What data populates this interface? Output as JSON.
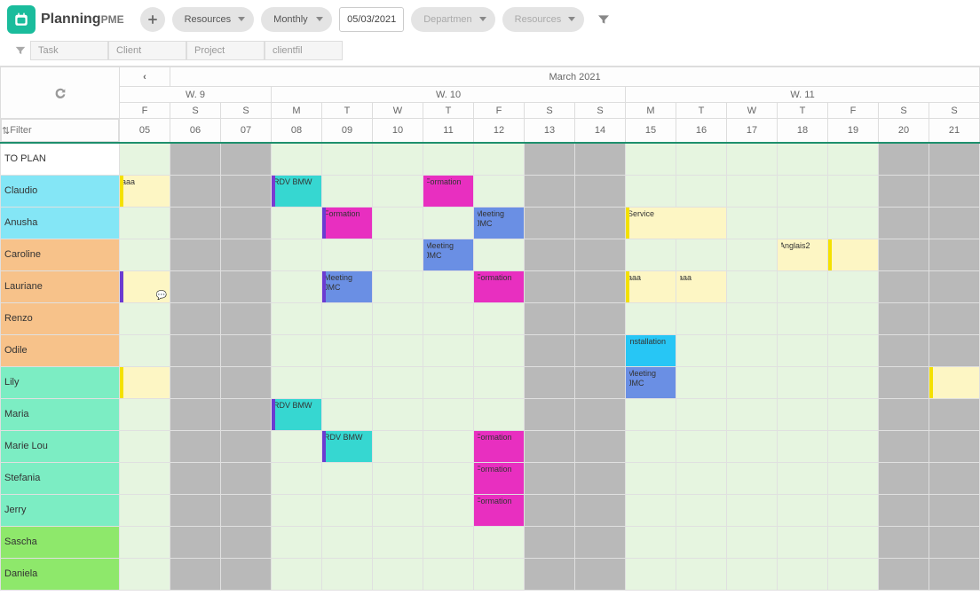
{
  "app": {
    "name": "Planning",
    "suffix": "PME"
  },
  "toolbar": {
    "resources_sel": "Resources",
    "view_sel": "Monthly",
    "date": "05/03/2021",
    "department_sel": "Departmen",
    "resources_sel2": "Resources"
  },
  "filters": {
    "task": "Task",
    "client": "Client",
    "project": "Project",
    "clientfil": "clientfil"
  },
  "calendar": {
    "month_label": "March 2021",
    "weeks": [
      "W. 9",
      "W. 10",
      "W. 11"
    ],
    "week_spans": [
      3,
      7,
      7
    ],
    "days": [
      "F",
      "S",
      "S",
      "M",
      "T",
      "W",
      "T",
      "F",
      "S",
      "S",
      "M",
      "T",
      "W",
      "T",
      "F",
      "S",
      "S"
    ],
    "daynums": [
      "05",
      "06",
      "07",
      "08",
      "09",
      "10",
      "11",
      "12",
      "13",
      "14",
      "15",
      "16",
      "17",
      "18",
      "19",
      "20",
      "21"
    ],
    "weekend_cols": [
      1,
      2,
      8,
      9,
      15,
      16
    ],
    "lightgreen_cols": [
      0,
      3,
      4,
      5,
      6,
      7,
      10,
      11,
      12,
      13,
      14
    ],
    "filter_placeholder": "Filter"
  },
  "resources": [
    {
      "name": "TO PLAN",
      "color": "#ffffff"
    },
    {
      "name": "Claudio",
      "color": "#84e6f6"
    },
    {
      "name": "Anusha",
      "color": "#84e6f6"
    },
    {
      "name": "Caroline",
      "color": "#f7c28a"
    },
    {
      "name": "Lauriane",
      "color": "#f7c28a"
    },
    {
      "name": "Renzo",
      "color": "#f7c28a"
    },
    {
      "name": "Odile",
      "color": "#f7c28a"
    },
    {
      "name": "Lily",
      "color": "#7cedc3"
    },
    {
      "name": "Maria",
      "color": "#7cedc3"
    },
    {
      "name": "Marie Lou",
      "color": "#7cedc3"
    },
    {
      "name": "Stefania",
      "color": "#7cedc3"
    },
    {
      "name": "Jerry",
      "color": "#7cedc3"
    },
    {
      "name": "Sascha",
      "color": "#8ee86b"
    },
    {
      "name": "Daniela",
      "color": "#8ee86b"
    }
  ],
  "events": [
    {
      "row": 1,
      "col": 0,
      "label": "aaa",
      "bg": "#fdf6c4",
      "stripe": "#f4e100"
    },
    {
      "row": 1,
      "col": 3,
      "label": "RDV BMW",
      "bg": "#36d7d1",
      "stripe": "#7a3bd1"
    },
    {
      "row": 1,
      "col": 6,
      "label": "Formation",
      "bg": "#e82fc0",
      "stripe": "#e82fc0"
    },
    {
      "row": 2,
      "col": 4,
      "label": "Formation",
      "bg": "#e82fc0",
      "stripe": "#6b3bd1"
    },
    {
      "row": 2,
      "col": 7,
      "label": "Meeting JMC",
      "bg": "#6a8fe4",
      "stripe": "#6a8fe4"
    },
    {
      "row": 2,
      "col": 10,
      "span": 2,
      "label": "Service",
      "bg": "#fdf6c4",
      "stripe": "#f4e100"
    },
    {
      "row": 3,
      "col": 6,
      "label": "Meeting JMC",
      "bg": "#6a8fe4",
      "stripe": "#6a8fe4"
    },
    {
      "row": 3,
      "col": 13,
      "label": "Anglais2",
      "bg": "#fdf6c4",
      "stripe": "#fdf6c4"
    },
    {
      "row": 3,
      "col": 14,
      "label": "",
      "bg": "#fdf6c4",
      "stripe": "#f4e100"
    },
    {
      "row": 4,
      "col": 0,
      "label": "",
      "bg": "#fdf6c4",
      "stripe": "#6b3bd1",
      "note": true
    },
    {
      "row": 4,
      "col": 4,
      "label": "Meeting JMC",
      "bg": "#6a8fe4",
      "stripe": "#6b3bd1"
    },
    {
      "row": 4,
      "col": 7,
      "label": "Formation",
      "bg": "#e82fc0",
      "stripe": "#e82fc0"
    },
    {
      "row": 4,
      "col": 10,
      "label": "aaa",
      "bg": "#fdf6c4",
      "stripe": "#f4e100"
    },
    {
      "row": 4,
      "col": 11,
      "label": "aaa",
      "bg": "#fdf6c4",
      "stripe": "#fdf6c4"
    },
    {
      "row": 6,
      "col": 10,
      "label": "Installation",
      "bg": "#27c6f5",
      "stripe": "#27c6f5"
    },
    {
      "row": 7,
      "col": 0,
      "label": "",
      "bg": "#fdf6c4",
      "stripe": "#f4e100"
    },
    {
      "row": 7,
      "col": 10,
      "label": "Meeting JMC",
      "bg": "#6a8fe4",
      "stripe": "#6a8fe4"
    },
    {
      "row": 7,
      "col": 16,
      "label": "",
      "bg": "#fdf6c4",
      "stripe": "#f4e100"
    },
    {
      "row": 8,
      "col": 3,
      "label": "RDV BMW",
      "bg": "#36d7d1",
      "stripe": "#6b3bd1"
    },
    {
      "row": 9,
      "col": 4,
      "label": "RDV BMW",
      "bg": "#36d7d1",
      "stripe": "#6b3bd1"
    },
    {
      "row": 9,
      "col": 7,
      "label": "Formation",
      "bg": "#e82fc0",
      "stripe": "#e82fc0"
    },
    {
      "row": 10,
      "col": 7,
      "label": "Formation",
      "bg": "#e82fc0",
      "stripe": "#e82fc0"
    },
    {
      "row": 11,
      "col": 7,
      "label": "Formation",
      "bg": "#e82fc0",
      "stripe": "#e82fc0"
    }
  ],
  "row_bg_overrides": {
    "12": {
      "wknd": "#c7c7c7",
      "lgn": "#d1f0c4"
    }
  }
}
